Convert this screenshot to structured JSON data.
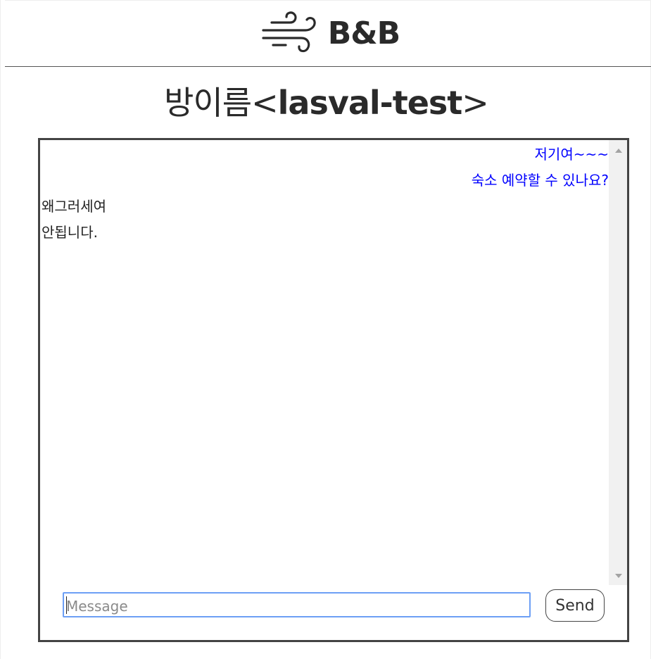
{
  "header": {
    "logo_icon": "wind-icon",
    "brand_name": "B&B"
  },
  "room": {
    "title_prefix": "방이름<",
    "room_name": "lasval-test",
    "title_suffix": ">"
  },
  "chat": {
    "messages": [
      {
        "side": "mine",
        "text": "저기여~~~"
      },
      {
        "side": "mine",
        "text": "숙소 예약할 수 있나요?"
      },
      {
        "side": "other",
        "text": "왜그러세여"
      },
      {
        "side": "other",
        "text": "안됩니다."
      }
    ],
    "colors": {
      "mine": "#0000ff",
      "other": "#222222"
    }
  },
  "composer": {
    "input_placeholder": "Message",
    "input_value": "",
    "send_label": "Send"
  }
}
